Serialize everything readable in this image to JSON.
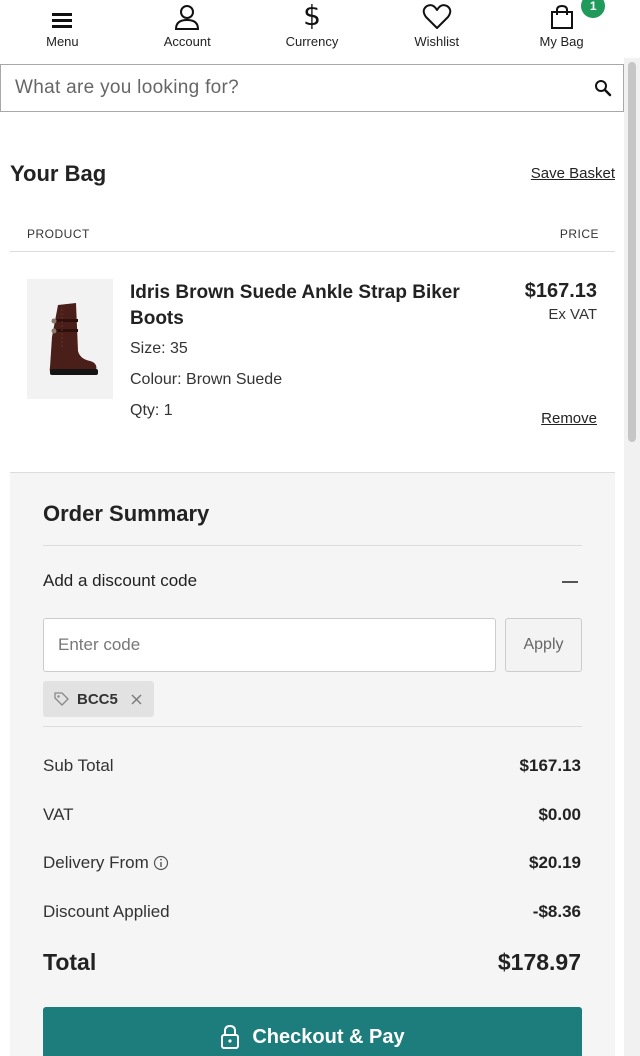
{
  "nav": {
    "menu_label": "Menu",
    "account_label": "Account",
    "currency_label": "Currency",
    "wishlist_label": "Wishlist",
    "bag_label": "My Bag",
    "bag_count": "1"
  },
  "search": {
    "placeholder": "What are you looking for?",
    "value": ""
  },
  "bag": {
    "title": "Your Bag",
    "save_basket": "Save Basket",
    "col_product": "PRODUCT",
    "col_price": "PRICE"
  },
  "item": {
    "name": "Idris Brown Suede Ankle Strap Biker Boots",
    "size": "Size: 35",
    "colour": "Colour: Brown Suede",
    "qty": "Qty: 1",
    "price": "$167.13",
    "vat_note": "Ex VAT",
    "remove": "Remove"
  },
  "summary": {
    "title": "Order Summary",
    "discount_label": "Add a discount code",
    "code_placeholder": "Enter code",
    "apply_label": "Apply",
    "applied_code": "BCC5",
    "rows": [
      {
        "label": "Sub Total",
        "value": "$167.13"
      },
      {
        "label": "VAT",
        "value": "$0.00"
      },
      {
        "label": "Delivery From",
        "value": "$20.19"
      },
      {
        "label": "Discount Applied",
        "value": "-$8.36"
      }
    ],
    "total_label": "Total",
    "total_value": "$178.97",
    "checkout_label": "Checkout & Pay"
  },
  "colors": {
    "accent": "#1d7c7c",
    "badge": "#1f9a5a"
  }
}
